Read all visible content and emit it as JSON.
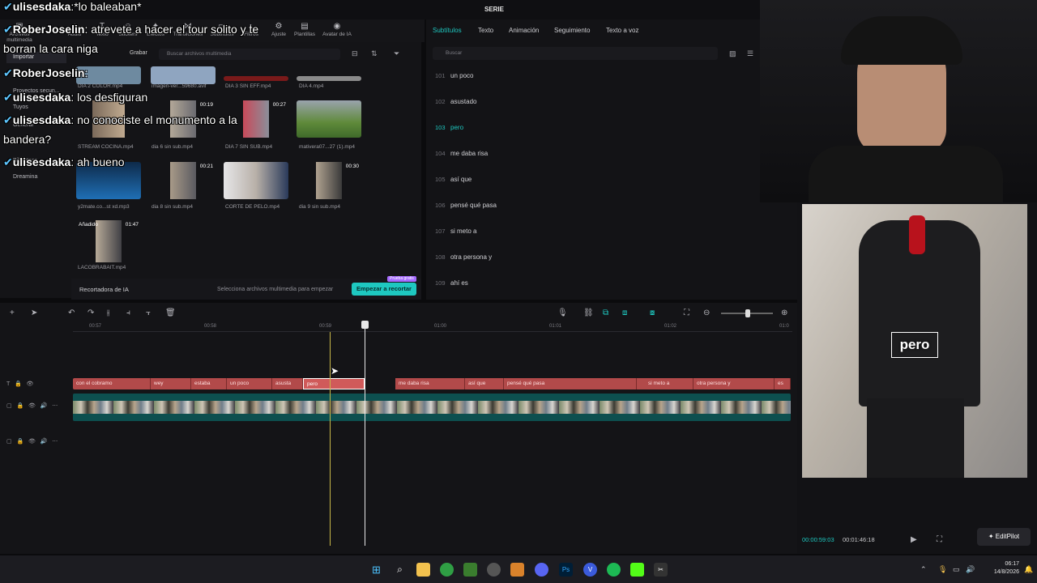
{
  "app": {
    "title": "SERIE"
  },
  "toolbar": [
    {
      "icon": "folder-icon",
      "label": "Archivos multimedia"
    },
    {
      "icon": "audio-icon",
      "label": "Audio"
    },
    {
      "icon": "text-icon",
      "label": "Texto"
    },
    {
      "icon": "sticker-icon",
      "label": "Stickers"
    },
    {
      "icon": "effects-icon",
      "label": "Efectos"
    },
    {
      "icon": "transitions-icon",
      "label": "Transiciones"
    },
    {
      "icon": "subtitles-icon",
      "label": "Subtítulos"
    },
    {
      "icon": "filters-icon",
      "label": "Filtros"
    },
    {
      "icon": "adjust-icon",
      "label": "Ajuste"
    },
    {
      "icon": "templates-icon",
      "label": "Plantillas"
    },
    {
      "icon": "avatar-icon",
      "label": "Avatar de IA"
    }
  ],
  "leftnav": [
    "Importar",
    "Proyectos secun...",
    "Tuyos",
    "General",
    "Biblioteca",
    "Dreamina"
  ],
  "media": {
    "grabar": "Grabar",
    "search_placeholder": "Buscar archivos multimedia",
    "items": [
      {
        "name": "DIA 2 COLOR.mp4",
        "duration": ""
      },
      {
        "name": "imagen-ver...59680.avif",
        "duration": ""
      },
      {
        "name": "DIA 3 SIN EFF.mp4",
        "duration": ""
      },
      {
        "name": "DIA 4.mp4",
        "duration": ""
      },
      {
        "name": "STREAM COCINA.mp4",
        "duration": ""
      },
      {
        "name": "dia 6 sin sub.mp4",
        "duration": "00:19"
      },
      {
        "name": "DIA 7 SIN SUB.mp4",
        "duration": "00:27"
      },
      {
        "name": "mativera07...27 (1).mp4",
        "duration": ""
      },
      {
        "name": "y2mate.co...st xd.mp3",
        "duration": ""
      },
      {
        "name": "dia 8 sin sub.mp4",
        "duration": "00:21"
      },
      {
        "name": "CORTE DE PELO.mp4",
        "duration": ""
      },
      {
        "name": "dia 9 sin sub.mp4",
        "duration": "00:30"
      },
      {
        "name": "LACOBRABAIT.mp4",
        "duration": "01:47",
        "added": "Añadido"
      }
    ],
    "footer": {
      "ai": "Recortadora de IA",
      "hint": "Selecciona archivos multimedia para empezar",
      "button": "Empezar a recortar",
      "badge": "Prueba gratis"
    }
  },
  "subs": {
    "tabs": [
      "Subtítulos",
      "Texto",
      "Animación",
      "Seguimiento",
      "Texto a voz"
    ],
    "search": "Buscar",
    "rows": [
      {
        "n": "101",
        "t": "un poco"
      },
      {
        "n": "102",
        "t": "asustado"
      },
      {
        "n": "103",
        "t": "pero",
        "active": true
      },
      {
        "n": "104",
        "t": "me daba risa"
      },
      {
        "n": "105",
        "t": "así que"
      },
      {
        "n": "106",
        "t": "pensé qué pasa"
      },
      {
        "n": "107",
        "t": "si meto a"
      },
      {
        "n": "108",
        "t": "otra persona y"
      },
      {
        "n": "109",
        "t": "ahí es"
      }
    ]
  },
  "ruler": [
    "00:57",
    "00:58",
    "00:59",
    "01:00",
    "01:01",
    "01:02",
    "01:0"
  ],
  "captions": [
    "con el cobramo",
    "wey",
    "estaba",
    "un poco",
    "asusta",
    "pero",
    "me daba risa",
    "así que",
    "pensé qué pasa",
    "si meto a",
    "otra persona y",
    "es"
  ],
  "preview": {
    "caption": "pero",
    "current": "00:00:59:03",
    "total": "00:01:46:18",
    "editpilot": "EditPilot"
  },
  "chat": [
    {
      "user": "ulisesdaka",
      "msg": ":*lo baleaban*"
    },
    {
      "user": "RoberJoselin",
      "msg": ": atrevete a hacer el tour solito y te"
    },
    {
      "user": "",
      "msg": "borran la cara niga"
    },
    {
      "user": "RoberJoselin",
      "msg": ":"
    },
    {
      "user": "ulisesdaka",
      "msg": ": los desfiguran"
    },
    {
      "user": "ulisesdaka",
      "msg": ": no conociste el monumento a la"
    },
    {
      "user": "",
      "msg": "bandera?"
    },
    {
      "user": "ulisesdaka",
      "msg": ": ah bueno"
    }
  ],
  "clock": {
    "time": "06:17",
    "date": "14/8/2026"
  },
  "colors": {
    "accent": "#1ec8c0",
    "caption_track": "#b24a4a",
    "video_track": "#0d4f4f"
  }
}
